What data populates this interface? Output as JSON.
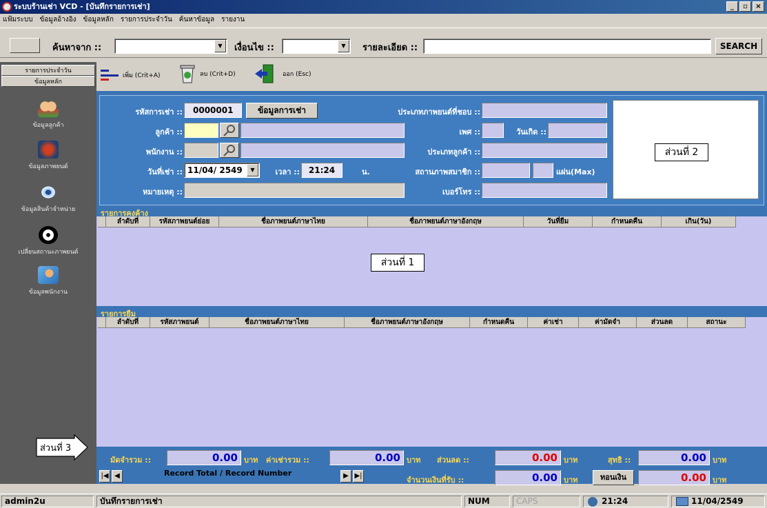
{
  "window": {
    "title": "ระบบร้านเช่า VCD - [บันทึกรายการเช่า]",
    "minimize": "_",
    "restore": "▫",
    "close": "×"
  },
  "menu": [
    "แฟ้มระบบ",
    "ข้อมูลอ้างอิง",
    "ข้อมูลหลัก",
    "รายการประจำวัน",
    "ค้นหาข้อมูล",
    "รายงาน"
  ],
  "search": {
    "search_from_label": "ค้นหาจาก ::",
    "condition_label": "เงื่อนไข ::",
    "detail_label": "รายละเอียด ::",
    "search_button": "SEARCH"
  },
  "sidebar": {
    "tab_daily": "รายการประจำวัน",
    "tab_master": "ข้อมูลหลัก",
    "items": [
      {
        "label": "ข้อมูลลูกค้า",
        "icon": "users-icon"
      },
      {
        "label": "ข้อมูลภาพยนต์",
        "icon": "movie-icon"
      },
      {
        "label": "ข้อมูลสินค้าจำหน่าย",
        "icon": "eye-disc-icon"
      },
      {
        "label": "เปลี่ยนสถานะภาพยนต์",
        "icon": "disc-icon"
      },
      {
        "label": "ข้อมูลพนักงาน",
        "icon": "employee-icon"
      }
    ]
  },
  "toolbar": {
    "add_label": "เพิ่ม (Crit+A)",
    "delete_label": "ลบ (Crit+D)",
    "exit_label": "ออก (Esc)"
  },
  "form": {
    "rental_id_label": "รหัสการเช่า ::",
    "rental_id_value": "0000001",
    "rental_info_button": "ข้อมูลการเช่า",
    "customer_label": "ลูกค้า ::",
    "employee_label": "พนักงาน ::",
    "rent_date_label": "วันที่เช่า ::",
    "rent_date_value": "11/04/ 2549",
    "time_label": "เวลา ::",
    "time_value": "21:24",
    "time_unit": "น.",
    "note_label": "หมายเหตุ ::",
    "fav_genre_label": "ประเภทภาพยนต์ที่ชอบ ::",
    "sex_label": "เพศ ::",
    "birthday_label": "วันเกิด ::",
    "customer_type_label": "ประเภทลูกค้า ::",
    "member_status_label": "สถานภาพสมาชิก ::",
    "max_discs_label": "แผ่น(Max)",
    "phone_label": "เบอร์โทร ::"
  },
  "section_labels": {
    "part1": "ส่วนที่ 1",
    "part2": "ส่วนที่ 2",
    "part3": "ส่วนที่ 3"
  },
  "outstanding": {
    "title": "รายการคงค้าง",
    "columns": [
      "ลำดับที่",
      "รหัสภาพยนต์ย่อย",
      "ชื่อภาพยนต์ภาษาไทย",
      "ชื่อภาพยนต์ภาษาอังกฤษ",
      "วันที่ยืม",
      "กำหนดคืน",
      "เกิน(วัน)"
    ]
  },
  "borrow": {
    "title": "รายการยืม",
    "columns": [
      "ลำดับที่",
      "รหัสภาพยนต์",
      "ชื่อภาพยนต์ภาษาไทย",
      "ชื่อภาพยนต์ภาษาอังกฤษ",
      "กำหนดคืน",
      "ค่าเช่า",
      "ค่ามัดจำ",
      "ส่วนลด",
      "สถานะ"
    ]
  },
  "footer": {
    "deposit_label": "มัดจำรวม ::",
    "deposit_value": "0.00",
    "rent_total_label": "ค่าเช่ารวม ::",
    "rent_total_value": "0.00",
    "discount_label": "ส่วนลด ::",
    "discount_value": "0.00",
    "net_label": "สุทธิ ::",
    "net_value": "0.00",
    "received_label": "จำนวนเงินที่รับ ::",
    "received_value": "0.00",
    "change_button": "ทอนเงิน",
    "change_value": "0.00",
    "currency": "บาท",
    "record_text": "Record Total / Record Number"
  },
  "statusbar": {
    "user": "admin2u",
    "screen": "บันทึกรายการเช่า",
    "num": "NUM",
    "caps": "CAPS",
    "time": "21:24",
    "date": "11/04/2549"
  },
  "colors": {
    "form_bg": "#3f7dc0",
    "grid_bg": "#c7c5f0",
    "value_red": "#e00000",
    "value_blue": "#0000c0",
    "section_yellow": "#ffd84a"
  }
}
